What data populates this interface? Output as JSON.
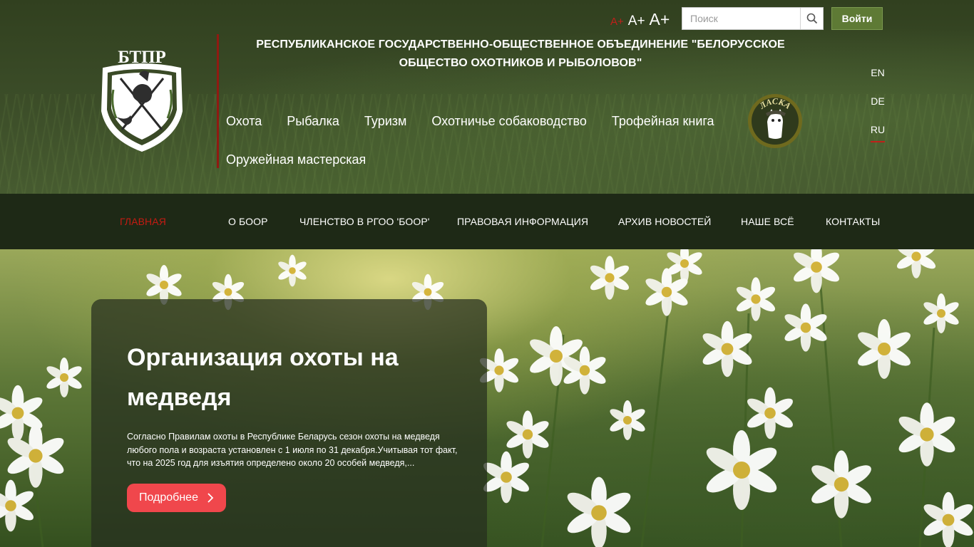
{
  "header": {
    "org_title": "РЕСПУБЛИКАНСКОЕ ГОСУДАРСТВЕННО-ОБЩЕСТВЕННОЕ ОБЪЕДИНЕНИЕ \"БЕЛОРУССКОЕ ОБЩЕСТВО ОХОТНИКОВ И РЫБОЛОВОВ\"",
    "logo_text": "БТПР",
    "laska_text": "ЛАСКА",
    "font_sizes": [
      "A+",
      "A+",
      "A+"
    ],
    "search_placeholder": "Поиск",
    "login_label": "Войти",
    "main_menu": [
      "Охота",
      "Рыбалка",
      "Туризм",
      "Охотничье собаководство",
      "Трофейная книга",
      "Оружейная мастерская"
    ],
    "languages": [
      "EN",
      "DE",
      "RU"
    ],
    "active_language": "RU"
  },
  "navbar": {
    "items": [
      "ГЛАВНАЯ",
      "О БООР",
      "ЧЛЕНСТВО В РГОО 'БООР'",
      "ПРАВОВАЯ ИНФОРМАЦИЯ",
      "АРХИВ НОВОСТЕЙ",
      "НАШЕ ВСЁ",
      "КОНТАКТЫ"
    ],
    "active": "ГЛАВНАЯ"
  },
  "hero": {
    "title": "Организация охоты на медведя",
    "text": "Согласно Правилам охоты в Республике Беларусь сезон охоты на медведя любого пола и возраста установлен с 1 июля по 31 декабря.Учитывая тот факт, что на 2025 год для изъятия определено около 20 особей медведя,...",
    "button_label": "Подробнее"
  },
  "colors": {
    "accent_red": "#c41b12",
    "login_green": "#5e7a35",
    "navbar_bg": "#1e2916",
    "hero_button": "#f0474c"
  },
  "icons": {
    "search": "search-icon",
    "chevron": "chevron-right-icon",
    "logo": "btpr-emblem-icon",
    "laska": "laska-badge-icon"
  }
}
